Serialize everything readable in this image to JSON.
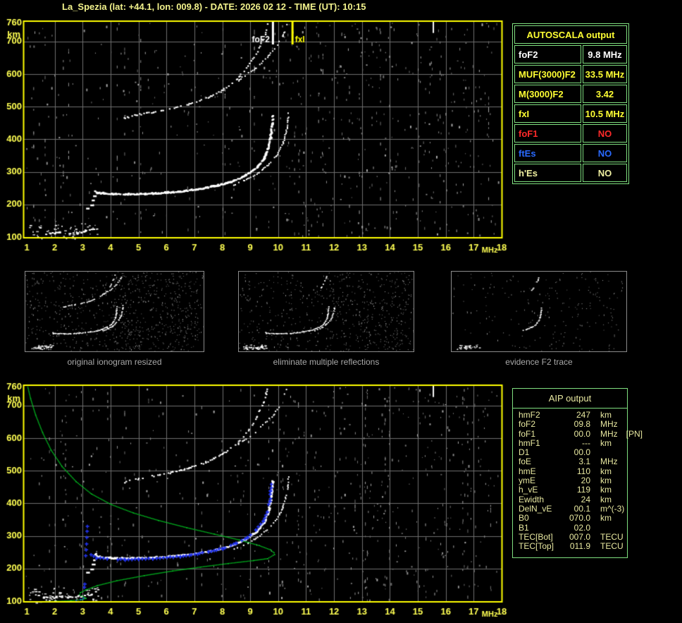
{
  "title": "La_Spezia (lat: +44.1, lon: 009.8) - DATE: 2026 02 12 - TIME (UT): 10:15",
  "colors": {
    "background": "#000000",
    "axis_yellow": "#FFFF52",
    "border_yellow": "#FFFF00",
    "grid_gray": "#6F6F6F",
    "trace_white": "#FFFFFF",
    "profile_green": "#00CC22",
    "trace_blue": "#2233EE",
    "caption_gray": "#A8A8A8",
    "table_border_green": "#7FDF7F",
    "aip_text": "#E8E8A0",
    "red": "#FF2A2A",
    "blue": "#2A6AFF",
    "pale_yellow": "#F0F0A0",
    "yellow": "#FFFF33"
  },
  "autoscala_table": {
    "title": "AUTOSCALA output",
    "rows": [
      {
        "label": "foF2",
        "value": "9.8 MHz",
        "color": "#FFFFFF"
      },
      {
        "label": "MUF(3000)F2",
        "value": "33.5 MHz",
        "color": "#FFFF33"
      },
      {
        "label": "M(3000)F2",
        "value": "3.42",
        "color": "#FFFF33"
      },
      {
        "label": "fxI",
        "value": "10.5 MHz",
        "color": "#FFFF33"
      },
      {
        "label": "foF1",
        "value": "NO",
        "color": "#FF2A2A"
      },
      {
        "label": "ftEs",
        "value": "NO",
        "color": "#2A6AFF"
      },
      {
        "label": "h'Es",
        "value": "NO",
        "color": "#F0F0A0"
      }
    ]
  },
  "aip_table": {
    "title": "AIP output",
    "rows": [
      {
        "label": "hmF2",
        "value": "247",
        "unit": "km",
        "note": ""
      },
      {
        "label": "foF2",
        "value": "09.8",
        "unit": "MHz",
        "note": ""
      },
      {
        "label": "foF1",
        "value": "00.0",
        "unit": "MHz",
        "note": "[PN]"
      },
      {
        "label": "hmF1",
        "value": "---",
        "unit": "km",
        "note": ""
      },
      {
        "label": "D1",
        "value": "00.0",
        "unit": "",
        "note": ""
      },
      {
        "label": "foE",
        "value": "3.1",
        "unit": "MHz",
        "note": ""
      },
      {
        "label": "hmE",
        "value": "110",
        "unit": "km",
        "note": ""
      },
      {
        "label": "ymE",
        "value": "20",
        "unit": "km",
        "note": ""
      },
      {
        "label": "h_vE",
        "value": "119",
        "unit": "km",
        "note": ""
      },
      {
        "label": "Ewidth",
        "value": "24",
        "unit": "km",
        "note": ""
      },
      {
        "label": "DelN_vE",
        "value": "00.1",
        "unit": "m^(-3)",
        "note": ""
      },
      {
        "label": "B0",
        "value": "070.0",
        "unit": "km",
        "note": ""
      },
      {
        "label": "B1",
        "value": "02.0",
        "unit": "",
        "note": ""
      },
      {
        "label": "TEC[Bot]",
        "value": "007.0",
        "unit": "TECU",
        "note": ""
      },
      {
        "label": "TEC[Top]",
        "value": "011.9",
        "unit": "TECU",
        "note": ""
      }
    ]
  },
  "thumbnails": [
    {
      "caption": "original ionogram resized"
    },
    {
      "caption": "eliminate multiple reflections"
    },
    {
      "caption": "evidence F2 trace"
    }
  ],
  "chart_data": {
    "type": "scatter",
    "description": "Ionogram (virtual height km vs sounding frequency MHz); top = scaled ionogram, bottom = same ionogram with restored trace (blue) and electron density profile (green)",
    "x_label": "MHz",
    "y_label": "km",
    "x_ticks": [
      1,
      2,
      3,
      4,
      5,
      6,
      7,
      8,
      9,
      10,
      11,
      12,
      13,
      14,
      15,
      16,
      17,
      18
    ],
    "y_ticks": [
      760,
      700,
      600,
      500,
      400,
      300,
      200,
      100
    ],
    "x_range": [
      1,
      18
    ],
    "y_range": [
      100,
      760
    ],
    "markers": [
      {
        "label": "foF2",
        "freq_mhz": 9.8,
        "color": "#FFFFFF",
        "side": "left"
      },
      {
        "label": "fxI",
        "freq_mhz": 10.5,
        "color": "#FFFF00",
        "side": "right"
      }
    ],
    "traces": {
      "e_region": [
        [
          1.55,
          112
        ],
        [
          2.0,
          114
        ],
        [
          2.5,
          115
        ],
        [
          3.0,
          118
        ],
        [
          3.3,
          124
        ],
        [
          3.45,
          133
        ]
      ],
      "f2_ordinary": [
        [
          3.42,
          244
        ],
        [
          3.5,
          237
        ],
        [
          4,
          234
        ],
        [
          4.6,
          233
        ],
        [
          5.2,
          234
        ],
        [
          6,
          238
        ],
        [
          6.6,
          243
        ],
        [
          7.2,
          250
        ],
        [
          7.8,
          260
        ],
        [
          8.3,
          272
        ],
        [
          8.8,
          291
        ],
        [
          9.2,
          315
        ],
        [
          9.45,
          342
        ],
        [
          9.6,
          372
        ],
        [
          9.68,
          405
        ],
        [
          9.73,
          440
        ],
        [
          9.76,
          472
        ]
      ],
      "f2_extraordinary": [
        [
          8.4,
          262
        ],
        [
          8.9,
          280
        ],
        [
          9.3,
          300
        ],
        [
          9.7,
          330
        ],
        [
          9.95,
          356
        ],
        [
          10.15,
          390
        ],
        [
          10.27,
          425
        ],
        [
          10.33,
          460
        ],
        [
          10.35,
          482
        ]
      ],
      "second_hop_ordinary": [
        [
          4.35,
          465
        ],
        [
          5,
          478
        ],
        [
          5.6,
          487
        ],
        [
          6.2,
          497
        ],
        [
          6.8,
          510
        ],
        [
          7.4,
          528
        ],
        [
          8,
          553
        ],
        [
          8.5,
          585
        ],
        [
          8.9,
          625
        ],
        [
          9.2,
          665
        ],
        [
          9.45,
          710
        ],
        [
          9.6,
          755
        ]
      ],
      "second_hop_extraordinary": [
        [
          8.5,
          580
        ],
        [
          9.2,
          622
        ],
        [
          9.8,
          672
        ],
        [
          10.15,
          718
        ],
        [
          10.3,
          756
        ]
      ],
      "cusp_blobs": [
        [
          3.3,
          200
        ],
        [
          3.35,
          215
        ],
        [
          3.4,
          228
        ],
        [
          3.15,
          190
        ]
      ]
    },
    "artifact_streaks": [
      {
        "f": 15.53,
        "h1": 760,
        "h2": 726
      }
    ],
    "profile_green": [
      [
        1.02,
        758
      ],
      [
        1.12,
        722
      ],
      [
        1.3,
        672
      ],
      [
        1.55,
        618
      ],
      [
        1.85,
        565
      ],
      [
        2.25,
        514
      ],
      [
        2.75,
        468
      ],
      [
        3.3,
        430
      ],
      [
        4.0,
        398
      ],
      [
        4.8,
        372
      ],
      [
        5.7,
        349
      ],
      [
        6.7,
        327
      ],
      [
        7.7,
        307
      ],
      [
        8.6,
        289
      ],
      [
        9.3,
        272
      ],
      [
        9.7,
        259
      ],
      [
        9.83,
        250
      ],
      [
        9.85,
        244
      ],
      [
        9.6,
        232
      ],
      [
        9.1,
        226
      ],
      [
        8.2,
        217
      ],
      [
        7.2,
        206
      ],
      [
        6.2,
        194
      ],
      [
        5.2,
        180
      ],
      [
        4.2,
        164
      ],
      [
        3.5,
        149
      ],
      [
        3.1,
        136
      ],
      [
        2.9,
        127
      ],
      [
        2.88,
        121
      ],
      [
        3.0,
        115
      ],
      [
        3.1,
        110
      ],
      [
        2.95,
        106
      ],
      [
        2.6,
        103
      ],
      [
        2.1,
        101
      ],
      [
        1.5,
        100
      ],
      [
        1.0,
        100
      ]
    ],
    "restored_trace_blue": {
      "baseline": {
        "h_km": 100,
        "f_start": 1.0,
        "f_end": 2.58
      },
      "rise": [
        [
          2.6,
          100
        ],
        [
          2.75,
          103
        ],
        [
          2.9,
          107
        ],
        [
          3.0,
          110
        ]
      ],
      "cusp_column": [
        [
          3.05,
          143
        ],
        [
          3.07,
          153
        ],
        [
          3.1,
          240
        ],
        [
          3.12,
          258
        ],
        [
          3.13,
          276
        ],
        [
          3.14,
          296
        ],
        [
          3.15,
          315
        ],
        [
          3.16,
          330
        ]
      ],
      "points": [
        [
          3.3,
          242
        ],
        [
          3.5,
          233
        ],
        [
          4,
          229
        ],
        [
          4.5,
          228
        ],
        [
          5,
          229
        ],
        [
          5.5,
          231
        ],
        [
          6,
          234
        ],
        [
          6.5,
          238
        ],
        [
          7,
          244
        ],
        [
          7.5,
          252
        ],
        [
          8,
          262
        ],
        [
          8.5,
          278
        ],
        [
          8.9,
          297
        ],
        [
          9.2,
          318
        ],
        [
          9.45,
          345
        ],
        [
          9.6,
          375
        ],
        [
          9.68,
          406
        ],
        [
          9.73,
          438
        ],
        [
          9.76,
          458
        ]
      ]
    },
    "noise": {
      "base": 400,
      "right_extra": 170,
      "columns": 26,
      "e_fuzz": 55
    },
    "grid": true,
    "legend": "none"
  }
}
